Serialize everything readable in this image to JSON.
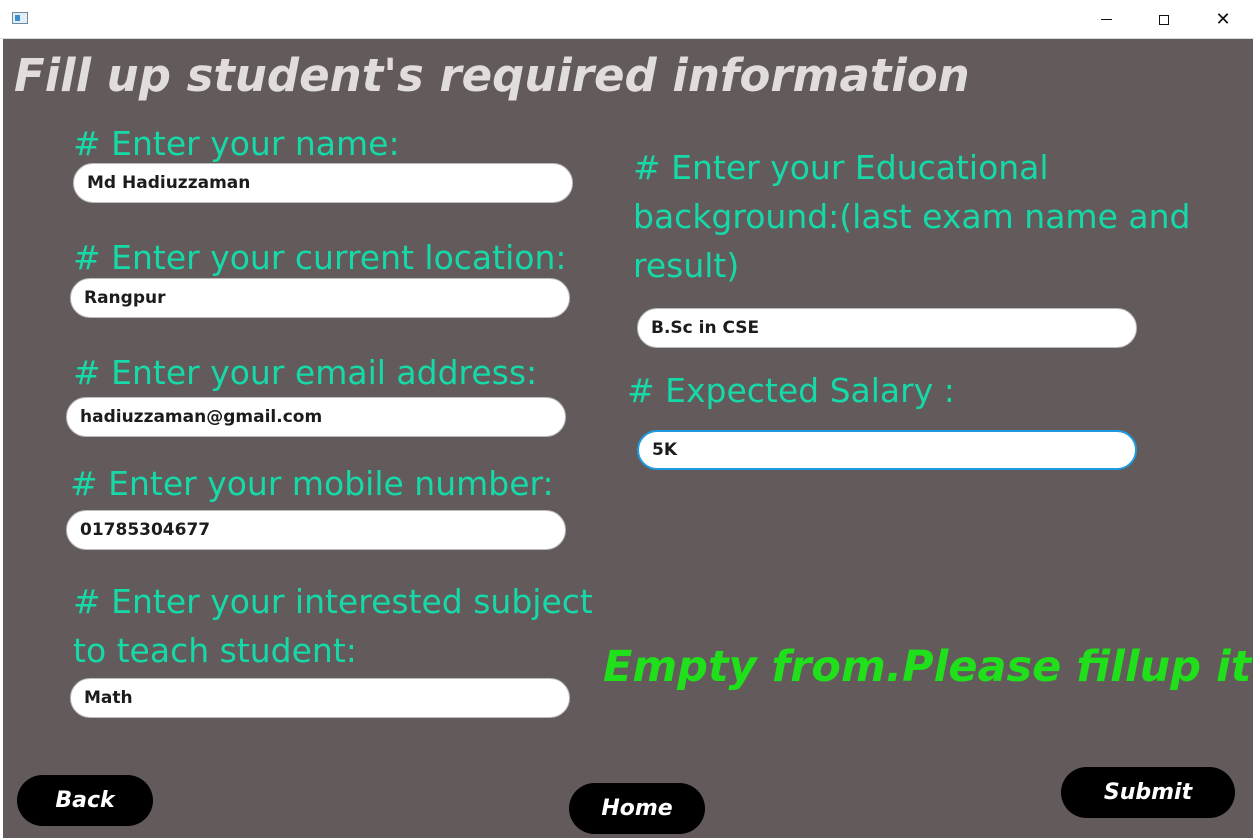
{
  "window": {
    "icons": {
      "app": "app-window-icon",
      "minimize": "minimize-icon",
      "maximize": "maximize-icon",
      "close": "close-icon"
    },
    "close_glyph": "✕"
  },
  "page": {
    "title": "Fill up student's  required information"
  },
  "form": {
    "name": {
      "label": "# Enter your name:",
      "value": "Md Hadiuzzaman"
    },
    "location": {
      "label": "# Enter your current location:",
      "value": "Rangpur"
    },
    "email": {
      "label": "# Enter your email address:",
      "value": "hadiuzzaman@gmail.com"
    },
    "mobile": {
      "label": "# Enter your mobile number:",
      "value": "01785304677"
    },
    "subject": {
      "label": "# Enter your interested subject to teach student:",
      "value": "Math"
    },
    "education": {
      "label": "# Enter your Educational background:(last exam name and result)",
      "value": "B.Sc in CSE"
    },
    "salary": {
      "label": "# Expected Salary :",
      "value": "5K"
    }
  },
  "status": {
    "message": "Empty from.Please fillup it"
  },
  "buttons": {
    "back": "Back",
    "home": "Home",
    "submit": "Submit"
  },
  "colors": {
    "background": "#635a5b",
    "label": "#16d9a8",
    "status": "#1fe01a",
    "title": "#e2dddd",
    "focus_border": "#1e9ae0"
  }
}
